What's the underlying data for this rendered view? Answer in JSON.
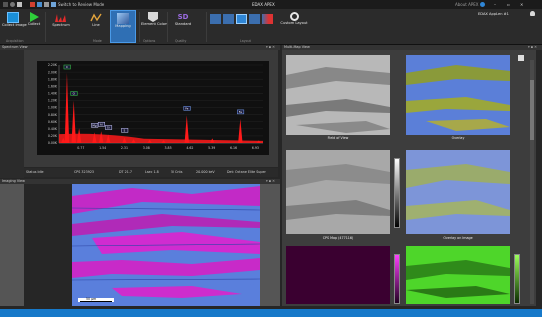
{
  "app": {
    "title": "EDAX APEX",
    "switch_mode": "Switch to Review Mode",
    "user": "EDAX AppLen #1",
    "top_right_small": "About APEX"
  },
  "ribbon": {
    "buttons": [
      {
        "label": "Collect Image",
        "name": "collect-image"
      },
      {
        "label": "Collect",
        "name": "collect"
      },
      {
        "label": "Spectrum",
        "name": "spectrum"
      },
      {
        "label": "Line",
        "name": "line"
      },
      {
        "label": "Mapping",
        "name": "mapping"
      },
      {
        "label": "Element Colors",
        "name": "element-colors"
      },
      {
        "label": "Standard",
        "name": "standard"
      },
      {
        "label": "Custom Layout",
        "name": "custom-layout"
      }
    ],
    "groups": [
      "Acquisition",
      "Mode",
      "Options",
      "Quality",
      "Layout"
    ],
    "quality_value": "SD"
  },
  "spectrum": {
    "title": "Spectrum View",
    "peaks": [
      "Mg",
      "Al",
      "Si",
      "S",
      "Fe",
      "Fe"
    ]
  },
  "chart_data": {
    "type": "line",
    "x_ticks": [
      "0.77",
      "1.54",
      "2.31",
      "3.08",
      "3.85",
      "4.62",
      "5.39",
      "6.16",
      "6.93"
    ],
    "y_ticks": [
      "2.20K",
      "2.00K",
      "1.80K",
      "1.60K",
      "1.40K",
      "1.20K",
      "1.00K",
      "0.80K",
      "0.60K",
      "0.40K",
      "0.20K",
      "0.00K"
    ],
    "ylim": [
      0,
      2200
    ],
    "xlim": [
      0,
      7.2
    ],
    "x": [
      0.15,
      0.28,
      0.52,
      0.71,
      1.25,
      1.49,
      1.74,
      2.31,
      2.63,
      3.2,
      3.69,
      4.51,
      5.41,
      6.4,
      7.05
    ],
    "values": [
      150,
      1980,
      1200,
      420,
      300,
      330,
      240,
      160,
      110,
      90,
      80,
      780,
      130,
      680,
      70
    ],
    "labels": [
      {
        "text": "C",
        "x": 0.28
      },
      {
        "text": "O",
        "x": 0.52
      },
      {
        "text": "Mg",
        "x": 1.25
      },
      {
        "text": "Al",
        "x": 1.49
      },
      {
        "text": "Si",
        "x": 1.74
      },
      {
        "text": "S",
        "x": 2.31
      },
      {
        "text": "Fe",
        "x": 4.51
      },
      {
        "text": "Fe",
        "x": 6.4
      }
    ]
  },
  "statusbar": {
    "status": "Status Idle",
    "cps": "CPS 323923",
    "dt": "DT 21.7",
    "live": "Lsec 1.8",
    "counts": "5l Cnts",
    "kev": "20.000 keV",
    "det": "Det: Octane Elite Super"
  },
  "imaging": {
    "title": "Imaging View",
    "scale": "50 μm"
  },
  "multimap": {
    "title": "Multi-Map View",
    "captions": [
      "Field of View",
      "Overlay",
      "CPS Map (477116)",
      "Overlay on Image"
    ]
  },
  "colors": {
    "accent": "#1779c9",
    "spectrum": "#ff1a1a",
    "overlay_blue": "#5b7fd8",
    "magenta": "#e020d0",
    "green": "#50e020"
  }
}
